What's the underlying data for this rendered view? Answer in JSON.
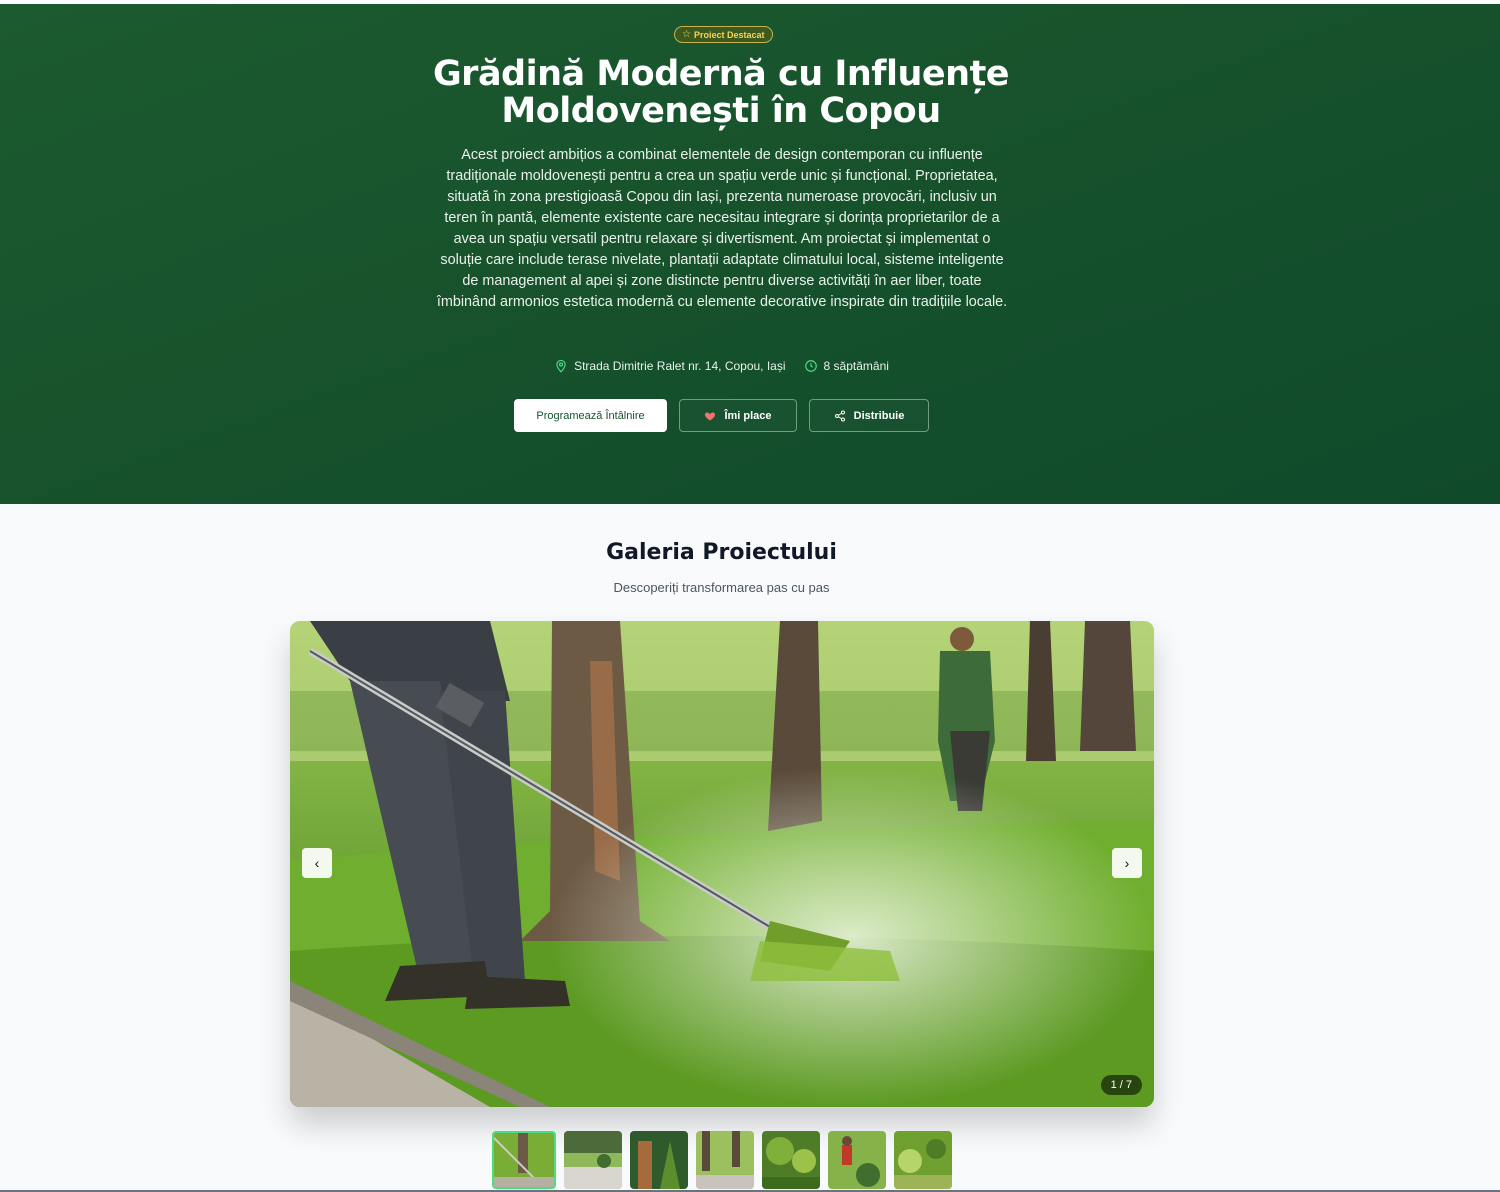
{
  "hero": {
    "badge": "Proiect Destacat",
    "title": "Grădină Modernă cu Influențe Moldovenești în Copou",
    "description": "Acest proiect ambițios a combinat elementele de design contemporan cu influențe tradiționale moldovenești pentru a crea un spațiu verde unic și funcțional. Proprietatea, situată în zona prestigioasă Copou din Iași, prezenta numeroase provocări, inclusiv un teren în pantă, elemente existente care necesitau integrare și dorința proprietarilor de a avea un spațiu versatil pentru relaxare și divertisment. Am proiectat și implementat o soluție care include terase nivelate, plantații adaptate climatului local, sisteme inteligente de management al apei și zone distincte pentru diverse activități în aer liber, toate îmbinând armonios estetica modernă cu elemente decorative inspirate din tradițiile locale.",
    "location": "Strada Dimitrie Ralet nr. 14, Copou, Iași",
    "duration": "8 săptămâni",
    "buttons": {
      "schedule": "Programează Întâlnire",
      "like": "Îmi place",
      "share": "Distribuie"
    }
  },
  "gallery": {
    "title": "Galeria Proiectului",
    "subtitle": "Descoperiți transformarea pas cu pas",
    "counter": "1 / 7",
    "prev_icon": "‹",
    "next_icon": "›",
    "thumbnail_count": 7
  },
  "colors": {
    "hero_green": "#17522c",
    "badge_gold": "#f5d45b",
    "active_thumb": "#4ade80"
  }
}
